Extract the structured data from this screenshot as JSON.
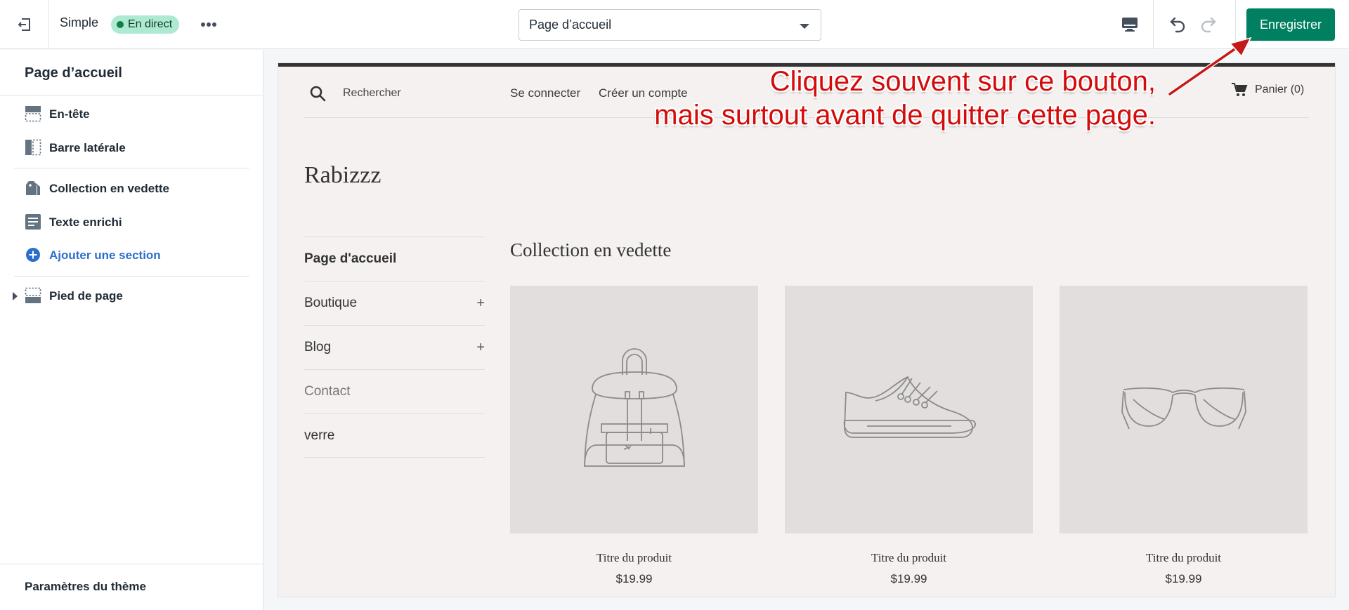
{
  "topbar": {
    "theme_name": "Simple",
    "live_badge": "En direct",
    "page_select": "Page d’accueil",
    "save_label": "Enregistrer"
  },
  "sidebar": {
    "title": "Page d’accueil",
    "items": [
      {
        "label": "En-tête",
        "icon": "header-layout-icon"
      },
      {
        "label": "Barre latérale",
        "icon": "sidebar-layout-icon"
      },
      {
        "label": "Collection en vedette",
        "icon": "collection-tag-icon"
      },
      {
        "label": "Texte enrichi",
        "icon": "rich-text-icon"
      },
      {
        "label": "Ajouter une section",
        "icon": "add-circle-icon"
      },
      {
        "label": "Pied de page",
        "icon": "footer-layout-icon"
      }
    ],
    "footer_label": "Paramètres du thème"
  },
  "preview": {
    "search_label": "Rechercher",
    "login": "Se connecter",
    "register": "Créer un compte",
    "cart": "Panier (0)",
    "logo": "Rabizzz",
    "nav": [
      {
        "label": "Page d'accueil"
      },
      {
        "label": "Boutique",
        "expand": "+"
      },
      {
        "label": "Blog",
        "expand": "+"
      },
      {
        "label": "Contact"
      },
      {
        "label": "verre"
      }
    ],
    "collection_title": "Collection en vedette",
    "products": [
      {
        "title": "Titre du produit",
        "price": "$19.99",
        "image": "backpack-illustration"
      },
      {
        "title": "Titre du produit",
        "price": "$19.99",
        "image": "sneaker-illustration"
      },
      {
        "title": "Titre du produit",
        "price": "$19.99",
        "image": "sunglasses-illustration"
      }
    ]
  },
  "annotation": {
    "line1": "Cliquez souvent sur ce bouton,",
    "line2": "mais surtout avant de quitter cette page.",
    "color": "#d40b0b"
  },
  "colors": {
    "primary": "#008060",
    "link": "#2c6ecb",
    "live_badge_bg": "#aee9d1"
  }
}
